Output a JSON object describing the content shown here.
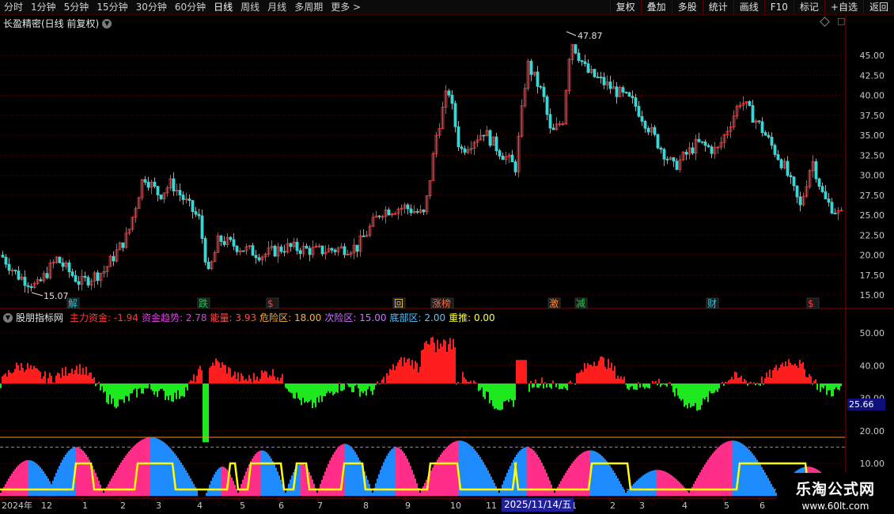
{
  "toolbar": {
    "periods": [
      "分时",
      "1分钟",
      "5分钟",
      "15分钟",
      "30分钟",
      "60分钟",
      "日线",
      "周线",
      "月线",
      "多周期",
      "更多"
    ],
    "active": "日线",
    "tools": [
      "复权",
      "叠加",
      "多股",
      "统计",
      "画线",
      "F10",
      "标记",
      "+自选",
      "返回"
    ]
  },
  "main_chart": {
    "title": "长盈精密(日线 前复权)",
    "high_label": "47.87",
    "low_label": "15.07",
    "y_ticks": [
      "45.00",
      "42.50",
      "40.00",
      "37.50",
      "35.00",
      "32.50",
      "30.00",
      "27.50",
      "25.00",
      "22.50",
      "20.00",
      "17.50",
      "15.00"
    ],
    "event_tags": [
      {
        "text": "解",
        "color": "#1ec8e0"
      },
      {
        "text": "跌",
        "color": "#1ecc4c"
      },
      {
        "text": "$",
        "color": "#ff3b3b"
      },
      {
        "text": "回",
        "color": "#f0c040"
      },
      {
        "text": "涨榜",
        "color": "#ff6a3b"
      },
      {
        "text": "激",
        "color": "#ff8c3b"
      },
      {
        "text": "减",
        "color": "#1ecc4c"
      },
      {
        "text": "财",
        "color": "#1ec8e0"
      },
      {
        "text": "$",
        "color": "#ff3b3b"
      }
    ]
  },
  "indicator": {
    "name": "股朋指标网",
    "values": [
      {
        "label": "主力资金",
        "value": "-1.94",
        "color": "#ff3b3b"
      },
      {
        "label": "资金趋势",
        "value": "2.78",
        "color": "#e040e0"
      },
      {
        "label": "能量",
        "value": "3.93",
        "color": "#ff5050"
      },
      {
        "label": "危险区",
        "value": "18.00",
        "color": "#ffb040"
      },
      {
        "label": "次险区",
        "value": "15.00",
        "color": "#d070ff"
      },
      {
        "label": "底部区",
        "value": "2.00",
        "color": "#50c8ff"
      },
      {
        "label": "重推",
        "value": "0.00",
        "color": "#ffff40"
      }
    ],
    "y_ticks": [
      "50.00",
      "40.00",
      "30.00",
      "20.00",
      "10.00"
    ],
    "current_value": "25.66"
  },
  "x_axis": {
    "labels": [
      "2024年",
      "12",
      "1",
      "2",
      "3",
      "4",
      "5",
      "6",
      "7",
      "8",
      "9",
      "10",
      "11",
      "2025/11/14/五",
      "1",
      "2",
      "3",
      "4",
      "5",
      "6"
    ]
  },
  "watermark": {
    "main": "乐淘公式网",
    "url": "www.60lt.com"
  },
  "colors": {
    "up": "#ff3b3b",
    "down": "#3ed4d4",
    "pos": "#ff1e1e",
    "neg": "#1ee81e",
    "pink": "#ff2e88",
    "blue": "#1e8cff",
    "yellow": "#ffff00",
    "orange": "#ff9020"
  }
}
